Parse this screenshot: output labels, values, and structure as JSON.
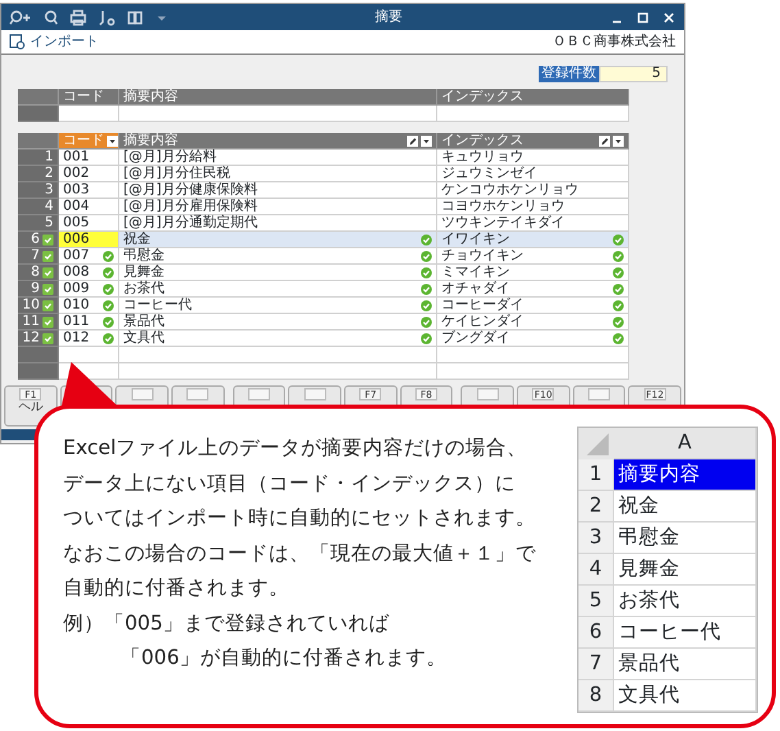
{
  "window": {
    "title": "摘要"
  },
  "toolbar": {
    "import_label": "インポート",
    "company": "ＯＢＣ商事株式会社"
  },
  "count": {
    "label": "登録件数",
    "value": "5"
  },
  "input_table": {
    "columns": [
      "コード",
      "摘要内容",
      "インデックス"
    ]
  },
  "list_table": {
    "columns": [
      "コード",
      "摘要内容",
      "インデックス"
    ],
    "rows": [
      {
        "number": "1",
        "code": "001",
        "summary": "[@月]月分給料",
        "index": "キュウリョウ",
        "imported": false,
        "code_checked": false,
        "selected": false
      },
      {
        "number": "2",
        "code": "002",
        "summary": "[@月]月分住民税",
        "index": "ジュウミンゼイ",
        "imported": false,
        "code_checked": false,
        "selected": false
      },
      {
        "number": "3",
        "code": "003",
        "summary": "[@月]月分健康保険料",
        "index": "ケンコウホケンリョウ",
        "imported": false,
        "code_checked": false,
        "selected": false
      },
      {
        "number": "4",
        "code": "004",
        "summary": "[@月]月分雇用保険料",
        "index": "コヨウホケンリョウ",
        "imported": false,
        "code_checked": false,
        "selected": false
      },
      {
        "number": "5",
        "code": "005",
        "summary": "[@月]月分通勤定期代",
        "index": "ツウキンテイキダイ",
        "imported": false,
        "code_checked": false,
        "selected": false
      },
      {
        "number": "6",
        "code": "006",
        "summary": "祝金",
        "index": "イワイキン",
        "imported": true,
        "code_checked": false,
        "selected": true
      },
      {
        "number": "7",
        "code": "007",
        "summary": "弔慰金",
        "index": "チョウイキン",
        "imported": true,
        "code_checked": true,
        "selected": false
      },
      {
        "number": "8",
        "code": "008",
        "summary": "見舞金",
        "index": "ミマイキン",
        "imported": true,
        "code_checked": true,
        "selected": false
      },
      {
        "number": "9",
        "code": "009",
        "summary": "お茶代",
        "index": "オチャダイ",
        "imported": true,
        "code_checked": true,
        "selected": false
      },
      {
        "number": "10",
        "code": "010",
        "summary": "コーヒー代",
        "index": "コーヒーダイ",
        "imported": true,
        "code_checked": true,
        "selected": false
      },
      {
        "number": "11",
        "code": "011",
        "summary": "景品代",
        "index": "ケイヒンダイ",
        "imported": true,
        "code_checked": true,
        "selected": false
      },
      {
        "number": "12",
        "code": "012",
        "summary": "文具代",
        "index": "ブングダイ",
        "imported": true,
        "code_checked": true,
        "selected": false
      }
    ]
  },
  "function_keys": [
    {
      "kind": "named",
      "key": "F1",
      "label": "ヘル"
    },
    {
      "kind": "blank"
    },
    {
      "kind": "blank"
    },
    {
      "kind": "blank"
    },
    {
      "kind": "blank"
    },
    {
      "kind": "blank"
    },
    {
      "kind": "named",
      "key": "F7"
    },
    {
      "kind": "named",
      "key": "F8"
    },
    {
      "kind": "blank"
    },
    {
      "kind": "named",
      "key": "F10"
    },
    {
      "kind": "blank"
    },
    {
      "kind": "named",
      "key": "F12"
    }
  ],
  "callout": {
    "lines": [
      "Excelファイル上のデータが摘要内容だけの場合、",
      "データ上にない項目（コード・インデックス）に",
      "ついてはインポート時に自動的にセットされます。",
      "なおこの場合のコードは、「現在の最大値＋１」で",
      "自動的に付番されます。",
      "例）「005」まで登録されていれば",
      "「006」が自動的に付番されます。"
    ],
    "sheet": {
      "column": "A",
      "rows": [
        {
          "number": "1",
          "value": "摘要内容",
          "selected": true
        },
        {
          "number": "2",
          "value": "祝金",
          "selected": false
        },
        {
          "number": "3",
          "value": "弔慰金",
          "selected": false
        },
        {
          "number": "4",
          "value": "見舞金",
          "selected": false
        },
        {
          "number": "5",
          "value": "お茶代",
          "selected": false
        },
        {
          "number": "6",
          "value": "コーヒー代",
          "selected": false
        },
        {
          "number": "7",
          "value": "景品代",
          "selected": false
        },
        {
          "number": "8",
          "value": "文具代",
          "selected": false
        }
      ]
    }
  }
}
